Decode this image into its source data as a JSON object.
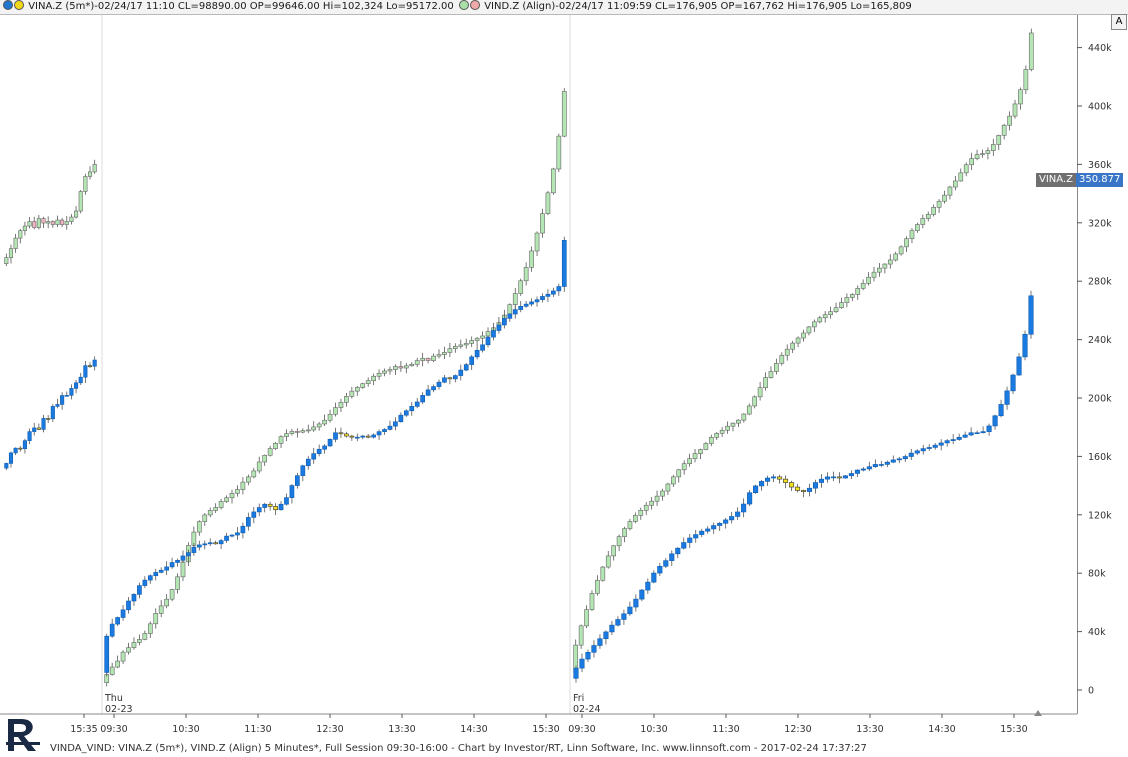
{
  "header": {
    "series1": {
      "label": "VINA.Z (5m*)-02/24/17 11:10 CL=98890.00 OP=99646.00 Hi=102,324 Lo=95172.00",
      "dot_colors": [
        "#1f77d0",
        "#f2d71a"
      ]
    },
    "series2": {
      "label": "VIND.Z (Align)-02/24/17 11:09:59 CL=176,905 OP=167,762 Hi=176,905 Lo=165,809",
      "dot_colors": [
        "#a8e0a8",
        "#f0a8a8"
      ]
    }
  },
  "a_button_label": "A",
  "price_tag": {
    "name": "VINA.Z",
    "value": "350.877"
  },
  "footer": {
    "text": "VINDA_VIND: VINA.Z (5m*), VIND.Z (Align) 5 Minutes*, Full Session 09:30-16:00 - Chart by Investor/RT, Linn Software, Inc. www.linnsoft.com - 2017-02-24 17:37:27"
  },
  "colors": {
    "up_green": "#b4e6b4",
    "down_pink": "#f2b4c0",
    "blue_bar": "#1a7ae0",
    "yellow_bar": "#f5e020",
    "grid_line": "#dddddd"
  },
  "chart_data": {
    "type": "candlestick",
    "y_axis": {
      "ticks": [
        "0",
        "40k",
        "80k",
        "120k",
        "160k",
        "200k",
        "240k",
        "280k",
        "320k",
        "360k",
        "400k",
        "440k"
      ],
      "tick_values": [
        0,
        40000,
        80000,
        120000,
        160000,
        200000,
        240000,
        280000,
        320000,
        360000,
        400000,
        440000
      ],
      "range": [
        -8000,
        452000
      ]
    },
    "x_axis": {
      "time_labels": [
        "15:35",
        "09:30",
        "10:30",
        "11:30",
        "12:30",
        "13:30",
        "14:30",
        "15:30",
        "09:30",
        "10:30",
        "11:30",
        "12:30",
        "13:30",
        "14:30",
        "15:30"
      ],
      "day_labels": [
        {
          "day": "Thu",
          "date": "02-23"
        },
        {
          "day": "Fri",
          "date": "02-24"
        }
      ]
    },
    "sessions": [
      {
        "name": "prior-afternoon",
        "green": {
          "start": 292000,
          "end": 360000,
          "steps": [
            4000,
            6000,
            7000,
            5000,
            3000,
            3000,
            -4000,
            6000,
            -3000,
            1000,
            -2000,
            3000,
            -3000,
            2000,
            3000,
            4000,
            13000,
            10000,
            3000,
            5000
          ]
        },
        "blue": {
          "start": 152000,
          "end": 226000
        }
      },
      {
        "name": "thursday",
        "green": {
          "start": 5000,
          "end": 410000,
          "steps": [
            11000,
            10000,
            8000,
            12000,
            6000,
            7000,
            4000,
            8000,
            13000,
            14000,
            10000,
            9000,
            13000,
            17000,
            20000,
            22000,
            18000,
            14000,
            9000,
            6000,
            4000,
            8000,
            5000,
            6000,
            5000,
            10000,
            7000,
            8000,
            12000,
            9000,
            9000,
            7000,
            9000,
            4000,
            3000,
            -1000,
            2000,
            1000,
            4000,
            4000,
            5000,
            8000,
            9000,
            7000,
            8000,
            7000,
            5000,
            5000,
            4000,
            6000,
            4000,
            3000,
            2000,
            4000,
            -2000,
            3000,
            2000,
            5000,
            3000,
            -3000,
            6000,
            2000,
            3000,
            5000,
            3000,
            2000,
            2000,
            4000,
            3000,
            3000,
            6000,
            5000,
            7000,
            10000,
            14000,
            15000,
            17000,
            18000,
            22000,
            24000,
            26000,
            28000,
            32000,
            44000,
            60000
          ]
        },
        "blue": {
          "start": 12000,
          "end": 308000,
          "steps": [
            33000,
            11000,
            6000,
            7000,
            8000,
            6000,
            8000,
            5000,
            4000,
            3000,
            2000,
            3000,
            4000,
            2000,
            4000,
            3000,
            5000,
            2000,
            1000,
            1000,
            -1000,
            3000,
            4000,
            1000,
            2000,
            6000,
            8000,
            5000,
            4000,
            3000,
            -2000,
            -3000,
            5000,
            6000,
            11000,
            9000,
            9000,
            6000,
            5000,
            4000,
            3000,
            6000,
            6000,
            -1000,
            -2000,
            -1000,
            0,
            1000,
            -1000,
            2000,
            3000,
            2000,
            3000,
            4000,
            6000,
            4000,
            4000,
            4000,
            6000,
            5000,
            3000,
            4000,
            4000,
            -1000,
            3000,
            5000,
            5000,
            7000,
            6000,
            5000,
            7000,
            6000,
            5000,
            6000,
            4000,
            4000,
            3000,
            2000,
            2000,
            2000,
            3000,
            2000,
            3000,
            4000,
            42000
          ]
        }
      },
      {
        "name": "friday",
        "green": {
          "start": 12000,
          "end": 450000,
          "steps": [
            27000,
            19000,
            16000,
            16000,
            13000,
            13000,
            11000,
            10000,
            9000,
            8000,
            7000,
            6000,
            5000,
            5000,
            4000,
            5000,
            5000,
            7000,
            7000,
            7000,
            6000,
            5000,
            5000,
            4000,
            6000,
            6000,
            4000,
            3000,
            4000,
            3000,
            3000,
            6000,
            8000,
            9000,
            9000,
            10000,
            6000,
            8000,
            8000,
            6000,
            6000,
            5000,
            5000,
            6000,
            5000,
            4000,
            3000,
            3000,
            4000,
            5000,
            5000,
            3000,
            6000,
            5000,
            6000,
            5000,
            4000,
            4000,
            4000,
            6000,
            7000,
            8000,
            8000,
            6000,
            6000,
            4000,
            7000,
            6000,
            6000,
            8000,
            6000,
            8000,
            8000,
            6000,
            4000,
            1000,
            3000,
            6000,
            9000,
            10000,
            9000,
            12000,
            14000,
            20000,
            36000
          ]
        },
        "blue": {
          "start": 8000,
          "end": 270000,
          "steps": [
            9000,
            8000,
            6000,
            6000,
            6000,
            6000,
            6000,
            5000,
            5000,
            6000,
            7000,
            8000,
            7000,
            8000,
            6000,
            5000,
            6000,
            5000,
            5000,
            4000,
            3000,
            3000,
            2000,
            3000,
            2000,
            3000,
            3000,
            4000,
            7000,
            10000,
            6000,
            4000,
            3000,
            1000,
            -2000,
            -3000,
            -4000,
            -3000,
            -1000,
            3000,
            5000,
            3000,
            2000,
            0,
            -1000,
            2000,
            2000,
            3000,
            1000,
            2000,
            2000,
            0,
            2000,
            2000,
            1000,
            2000,
            3000,
            2000,
            2000,
            1000,
            2000,
            2000,
            2000,
            1000,
            2000,
            2000,
            2000,
            0,
            1000,
            5000,
            9000,
            10000,
            12000,
            14000,
            16000,
            20000,
            34000
          ]
        }
      }
    ]
  }
}
